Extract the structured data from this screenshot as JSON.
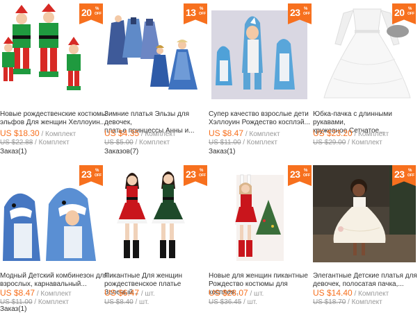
{
  "products": [
    {
      "discount": "20",
      "title_l1": "Новые рождественские костюмы",
      "title_l2": "эльфов Для женщин Хеллоуин...",
      "price": "US $18.30",
      "unit": " / Комплект",
      "old_price": "US $22.88",
      "old_unit": " / Комплект",
      "orders": "Заказ(1)"
    },
    {
      "discount": "13",
      "title_l1": "Зимние платья Эльзы для девочек,",
      "title_l2": "платье принцессы Анны и...",
      "price": "US $4.35",
      "unit": " / Комплект",
      "old_price": "US $5.00",
      "old_unit": " / Комплект",
      "orders": "Заказов(7)"
    },
    {
      "discount": "23",
      "title_l1": "Супер качество взрослые дети",
      "title_l2": "Хэллоуин Рождество косплэй...",
      "price": "US $8.47",
      "unit": " / Комплект",
      "old_price": "US $11.00",
      "old_unit": " / Комплект",
      "orders": "Заказ(1)"
    },
    {
      "discount": "20",
      "title_l1": "Юбка-пачка с длинными рукавами,",
      "title_l2": "кружевное Сетчатое...",
      "price": "US $23.20",
      "unit": " / Комплект",
      "old_price": "US $29.00",
      "old_unit": " / Комплект",
      "orders": ""
    },
    {
      "discount": "23",
      "title_l1": "Модный Детский комбинезон для",
      "title_l2": "взрослых, карнавальный...",
      "price": "US $8.47",
      "unit": " / Комплект",
      "old_price": "US $11.00",
      "old_unit": " / Комплект",
      "orders": "Заказ(1)"
    },
    {
      "discount": "23",
      "title_l1": "Пикантные Для женщин",
      "title_l2": "рождественское платье Зеленый...",
      "price": "US $6.47",
      "unit": " / шт.",
      "old_price": "US $8.40",
      "old_unit": " / шт.",
      "orders": ""
    },
    {
      "discount": "23",
      "title_l1": "Новые для женщин пикантные",
      "title_l2": "Рождество костюмы для косплея...",
      "price": "US $28.07",
      "unit": " / шт.",
      "old_price": "US $36.45",
      "old_unit": " / шт.",
      "orders": ""
    },
    {
      "discount": "23",
      "title_l1": "Элегантные Детские платья для",
      "title_l2": "девочек, полосатая пачка,...",
      "price": "US $14.40",
      "unit": " / Комплект",
      "old_price": "US $18.70",
      "old_unit": " / Комплект",
      "orders": ""
    }
  ],
  "badge_pct": "%",
  "badge_off": "OFF",
  "colors": {
    "accent": "#f7701e",
    "muted": "#999999"
  }
}
